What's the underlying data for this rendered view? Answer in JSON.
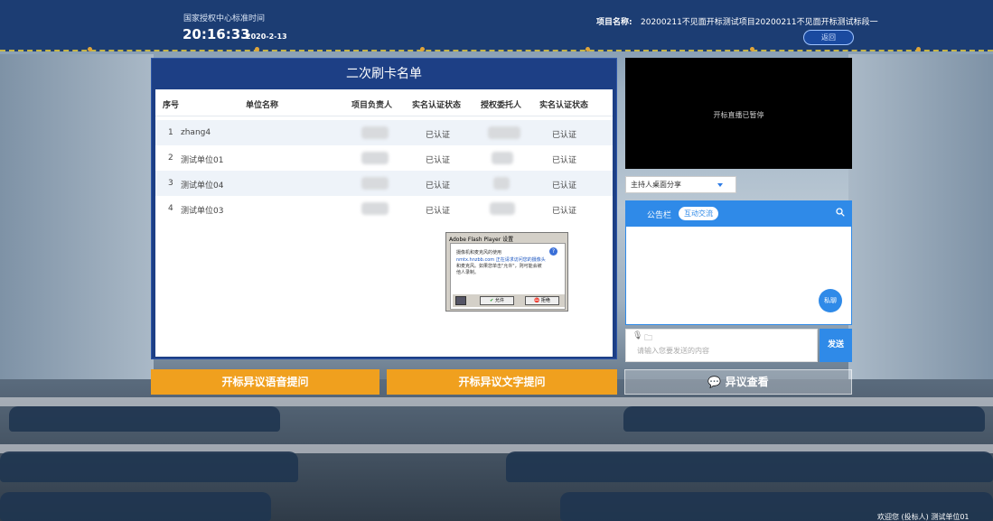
{
  "header": {
    "org": "国家授权中心标准时间",
    "clock": "20:16:33",
    "date": "2020-2-13",
    "project_label": "项目名称:",
    "project_name": "20200211不见面开标测试项目20200211不见面开标测试标段一",
    "back_button": "返回"
  },
  "panel": {
    "title": "二次刷卡名单",
    "columns": [
      "序号",
      "单位名称",
      "项目负责人",
      "实名认证状态",
      "授权委托人",
      "实名认证状态"
    ],
    "rows": [
      {
        "index": "1",
        "name": "zhang4",
        "status1": "已认证",
        "status2": "已认证"
      },
      {
        "index": "2",
        "name": "测试单位01",
        "status1": "已认证",
        "status2": "已认证"
      },
      {
        "index": "3",
        "name": "测试单位04",
        "status1": "已认证",
        "status2": "已认证"
      },
      {
        "index": "4",
        "name": "测试单位03",
        "status1": "已认证",
        "status2": "已认证"
      }
    ]
  },
  "flash_dialog": {
    "title": "Adobe Flash Player 设置",
    "line1": "摄像机和麦克风的使用",
    "line2": "nmtx.hnzbb.com 正在请求访问您的摄像头",
    "line3": "和麦克风。如果您单击\"允许\"，则可能会被",
    "line4": "他人录制。",
    "allow": "允许",
    "deny": "拒绝"
  },
  "buttons": {
    "voice_question": "开标异议语音提问",
    "text_question": "开标异议文字提问",
    "view_objection": "异议查看"
  },
  "video": {
    "status": "开标直播已暂停"
  },
  "share_select": {
    "value": "主持人桌面分享"
  },
  "chat": {
    "tab_notice": "公告栏",
    "tab_interact": "互动交流",
    "private_button": "私聊",
    "input_placeholder": "请输入您要发送的内容",
    "send_button": "发送"
  },
  "footer": {
    "welcome": "欢迎您    (投标人) 测试单位01"
  },
  "colors": {
    "header_bg": "#1c3d73",
    "panel_bg": "#1d3f85",
    "accent_orange": "#f0a01e",
    "accent_blue": "#2f8ae8"
  }
}
